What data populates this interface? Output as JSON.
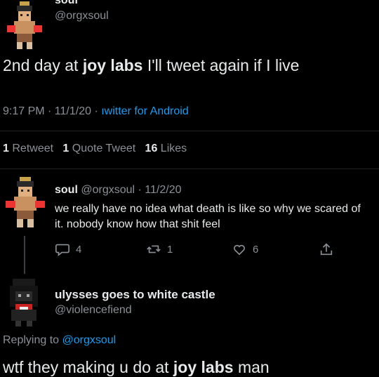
{
  "main_tweet": {
    "display_name": "soul",
    "handle": "@orgxsoul",
    "text_before": "2nd day at ",
    "text_bold": "joy labs",
    "text_after": " I'll tweet again if I live",
    "timestamp": "9:17 PM · 11/1/20 · ",
    "client": "ıwitter for Android",
    "stats": {
      "retweets_count": "1",
      "retweets_label": "Retweet",
      "quotes_count": "1",
      "quotes_label": "Quote Tweet",
      "likes_count": "16",
      "likes_label": "Likes"
    }
  },
  "reply_1": {
    "display_name": "soul",
    "handle": "@orgxsoul",
    "date": "· 11/2/20",
    "text": "we really have no idea what death is like so why we scared of it. nobody know how that shit feel",
    "actions": {
      "replies": "4",
      "retweets": "1",
      "likes": "6"
    }
  },
  "reply_2": {
    "display_name": "ulysses goes to white castle",
    "handle": "@violencefiend",
    "replying_prefix": "Replying to ",
    "replying_handle": "@orgxsoul",
    "text_before": "wtf they making u do at ",
    "text_bold": "joy labs",
    "text_after": " man"
  },
  "icons": {
    "reply": "speech-bubble-icon",
    "retweet": "retweet-arrows-icon",
    "like": "heart-icon",
    "share": "share-upload-icon"
  },
  "colors": {
    "background": "#000000",
    "text": "#e7e9ea",
    "muted": "#8b9096",
    "link": "#1d9bf0"
  }
}
